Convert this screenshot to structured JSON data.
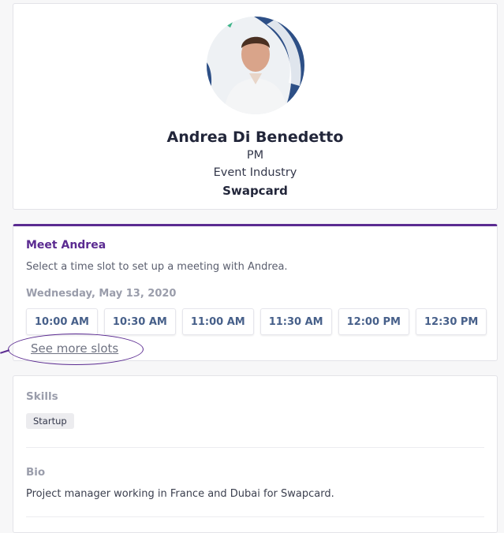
{
  "profile": {
    "name": "Andrea Di Benedetto",
    "role": "PM",
    "industry": "Event Industry",
    "company": "Swapcard"
  },
  "meet": {
    "title": "Meet Andrea",
    "description": "Select a time slot to set up a meeting with Andrea.",
    "date": "Wednesday, May 13, 2020",
    "slots": [
      "10:00 AM",
      "10:30 AM",
      "11:00 AM",
      "11:30 AM",
      "12:00 PM",
      "12:30 PM"
    ],
    "see_more": "See more slots"
  },
  "details": {
    "skills_label": "Skills",
    "skills": [
      "Startup"
    ],
    "bio_label": "Bio",
    "bio": "Project manager working in France and Dubai for Swapcard."
  },
  "colors": {
    "accent": "#5b2b91",
    "slot_text": "#47608a",
    "muted_label": "#9a9dab"
  }
}
